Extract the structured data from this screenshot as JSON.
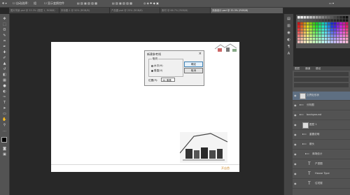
{
  "app": {
    "options_bar": [
      "自动选择：",
      "组",
      "显示变换控件"
    ],
    "document_tabs": [
      {
        "label": "图片背景.psd @ 33.3% (图层 1, RGB/8)",
        "active": false
      },
      {
        "label": "未标题-1 @ 50% (RGB/8)",
        "active": false
      },
      {
        "label": "产品图.psd @ 25% (RGB/8)",
        "active": false
      },
      {
        "label": "素材 @ 66.7% (RGB/8)",
        "active": false
      },
      {
        "label": "页面设计.psd @ 33.3% (RGB/8)",
        "active": true
      }
    ]
  },
  "dialog": {
    "title": "新建参考线",
    "orientation_legend": "取向",
    "horizontal_label": "水平(H)",
    "vertical_label": "垂直(V)",
    "ok_label": "确定",
    "cancel_label": "取消",
    "position_label": "位置(P):",
    "position_value": "34 像素"
  },
  "canvas": {
    "footer_text": "开店首"
  },
  "layers_panel": {
    "tabs": [
      "图层",
      "通道",
      "路径"
    ],
    "layers": [
      {
        "name": "交界处形状",
        "kind": "image",
        "selected": true,
        "indent": 0
      },
      {
        "name": "分析图",
        "kind": "group",
        "selected": false,
        "indent": 0
      },
      {
        "name": "background",
        "kind": "group",
        "selected": false,
        "indent": 0
      },
      {
        "name": "图层 1",
        "kind": "image",
        "selected": false,
        "indent": 1
      },
      {
        "name": "重要说明",
        "kind": "group",
        "selected": false,
        "indent": 1
      },
      {
        "name": "箭头",
        "kind": "group",
        "selected": false,
        "indent": 1
      },
      {
        "name": "商场设计",
        "kind": "group",
        "selected": false,
        "indent": 2
      },
      {
        "name": "户型图",
        "kind": "text",
        "selected": false,
        "indent": 3
      },
      {
        "name": "House Type",
        "kind": "text",
        "selected": false,
        "indent": 3
      },
      {
        "name": "住宅楼",
        "kind": "text",
        "selected": false,
        "indent": 3
      }
    ]
  },
  "colors": {
    "accent": "#3c7fb1",
    "selection": "#5e6f82"
  }
}
